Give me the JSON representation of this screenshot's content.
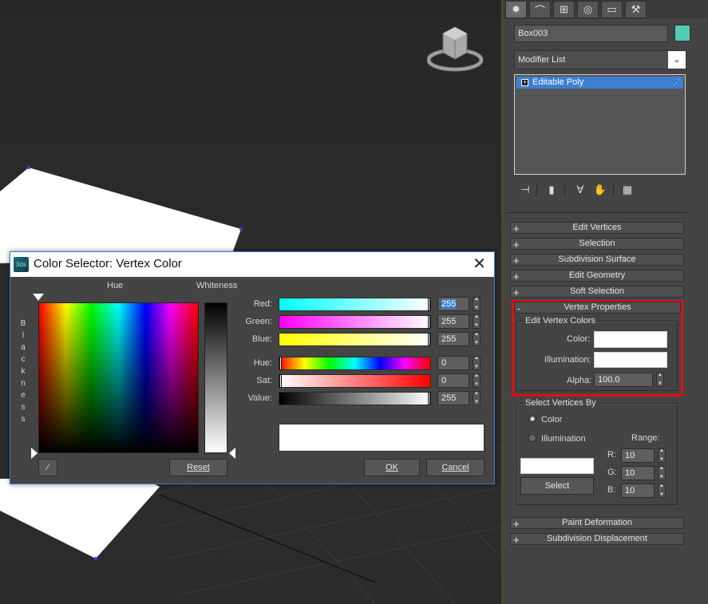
{
  "command_panel": {
    "tabs": [
      "create-icon",
      "modify-icon",
      "hierarchy-icon",
      "motion-icon",
      "display-icon",
      "utilities-icon"
    ],
    "object_name": "Box003",
    "object_color": "#4fcfb8",
    "modifier_list": "Modifier List",
    "stack_items": [
      "Editable Poly"
    ],
    "rollouts_top": [
      {
        "sign": "+",
        "label": "Edit Vertices"
      },
      {
        "sign": "+",
        "label": "Selection"
      },
      {
        "sign": "+",
        "label": "Subdivision Surface"
      },
      {
        "sign": "+",
        "label": "Edit Geometry"
      },
      {
        "sign": "+",
        "label": "Soft Selection"
      }
    ],
    "vertex_properties": {
      "sign": "-",
      "label": "Vertex Properties",
      "edit_vertex_colors": "Edit Vertex Colors",
      "color_label": "Color:",
      "illumination_label": "Illumination:",
      "alpha_label": "Alpha:",
      "alpha_value": "100.0"
    },
    "select_vertices_by": {
      "title": "Select Vertices By",
      "color_option": "Color",
      "illumination_option": "Illumination",
      "range_label": "Range:",
      "r_label": "R:",
      "r_value": "10",
      "g_label": "G:",
      "g_value": "10",
      "b_label": "B:",
      "b_value": "10",
      "select_button": "Select"
    },
    "rollouts_bottom": [
      {
        "sign": "+",
        "label": "Paint Deformation"
      },
      {
        "sign": "+",
        "label": "Subdivision Displacement"
      }
    ]
  },
  "dialog": {
    "title": "Color Selector: Vertex Color",
    "hue_label": "Hue",
    "whiteness_label": "Whiteness",
    "blackness_letters": [
      "B",
      "l",
      "a",
      "c",
      "k",
      "n",
      "e",
      "s",
      "s"
    ],
    "channels": [
      {
        "label": "Red:",
        "value": "255",
        "selected": true
      },
      {
        "label": "Green:",
        "value": "255",
        "selected": false
      },
      {
        "label": "Blue:",
        "value": "255",
        "selected": false
      },
      {
        "label": "Hue:",
        "value": "0",
        "selected": false
      },
      {
        "label": "Sat:",
        "value": "0",
        "selected": false
      },
      {
        "label": "Value:",
        "value": "255",
        "selected": false
      }
    ],
    "reset_label": "Reset",
    "ok_label": "OK",
    "cancel_label": "Cancel",
    "preview_color": "#ffffff"
  },
  "highlight_color": "#e01010"
}
